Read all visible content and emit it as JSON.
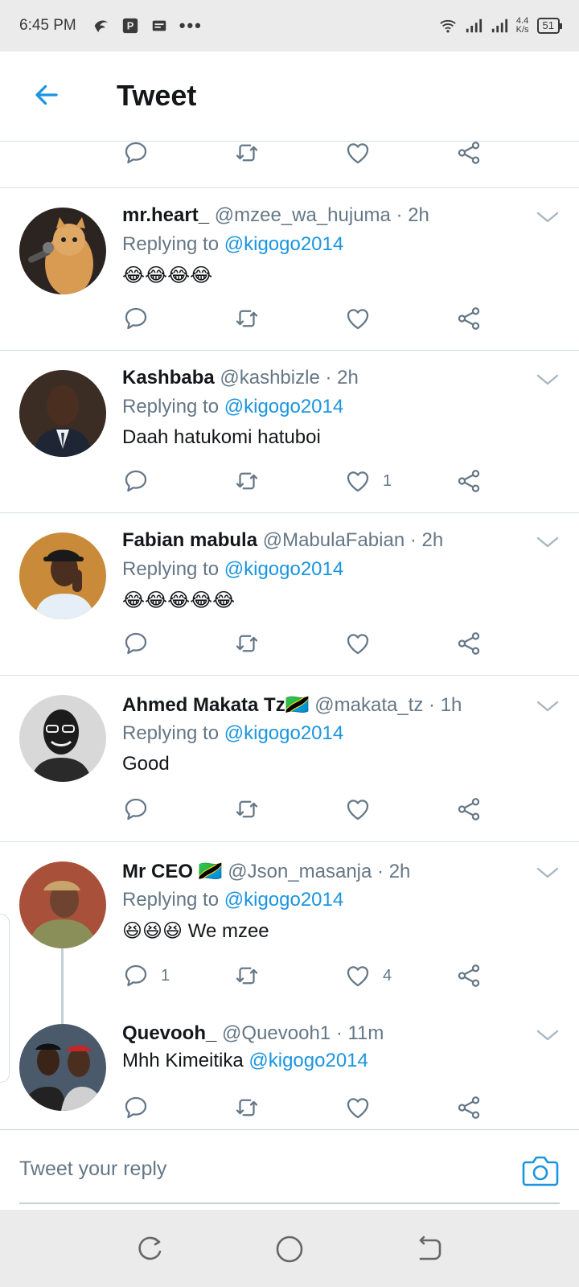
{
  "status_bar": {
    "time": "6:45 PM",
    "net_speed_value": "4.4",
    "net_speed_unit": "K/s",
    "battery": "51"
  },
  "header": {
    "title": "Tweet"
  },
  "tweets": [
    {
      "name": "mr.heart_",
      "handle": "@mzee_wa_hujuma",
      "time": "· 2h",
      "replying_prefix": "Replying to",
      "replying_to": "@kigogo2014",
      "body": "😂😂😂😂",
      "reply_count": "",
      "like_count": ""
    },
    {
      "name": "Kashbaba",
      "handle": "@kashbizle",
      "time": "· 2h",
      "replying_prefix": "Replying to",
      "replying_to": "@kigogo2014",
      "body": "Daah hatukomi hatuboi",
      "reply_count": "",
      "like_count": "1"
    },
    {
      "name": "Fabian mabula",
      "handle": "@MabulaFabian",
      "time": "· 2h",
      "replying_prefix": "Replying to",
      "replying_to": "@kigogo2014",
      "body": "😂😂😂😂😂",
      "reply_count": "",
      "like_count": ""
    },
    {
      "name": "Ahmed Makata Tz🇹🇿",
      "handle": "@makata_tz",
      "time": "· 1h",
      "replying_prefix": "Replying to",
      "replying_to": "@kigogo2014",
      "body": "Good",
      "reply_count": "",
      "like_count": ""
    },
    {
      "name": "Mr CEO 🇹🇿",
      "handle": "@Json_masanja",
      "time": "· 2h",
      "replying_prefix": "Replying to",
      "replying_to": "@kigogo2014",
      "body": "😆😆😆 We mzee",
      "reply_count": "1",
      "like_count": "4"
    },
    {
      "name": "Quevooh_",
      "handle": "@Quevooh1",
      "time": "· 11m",
      "body_text": "Mhh Kimeitika",
      "body_mention": "@kigogo2014"
    }
  ],
  "reply_bar": {
    "placeholder": "Tweet your reply"
  },
  "colors": {
    "accent": "#1b95e0",
    "icon_gray": "#657786",
    "divider": "#d6dde2"
  }
}
